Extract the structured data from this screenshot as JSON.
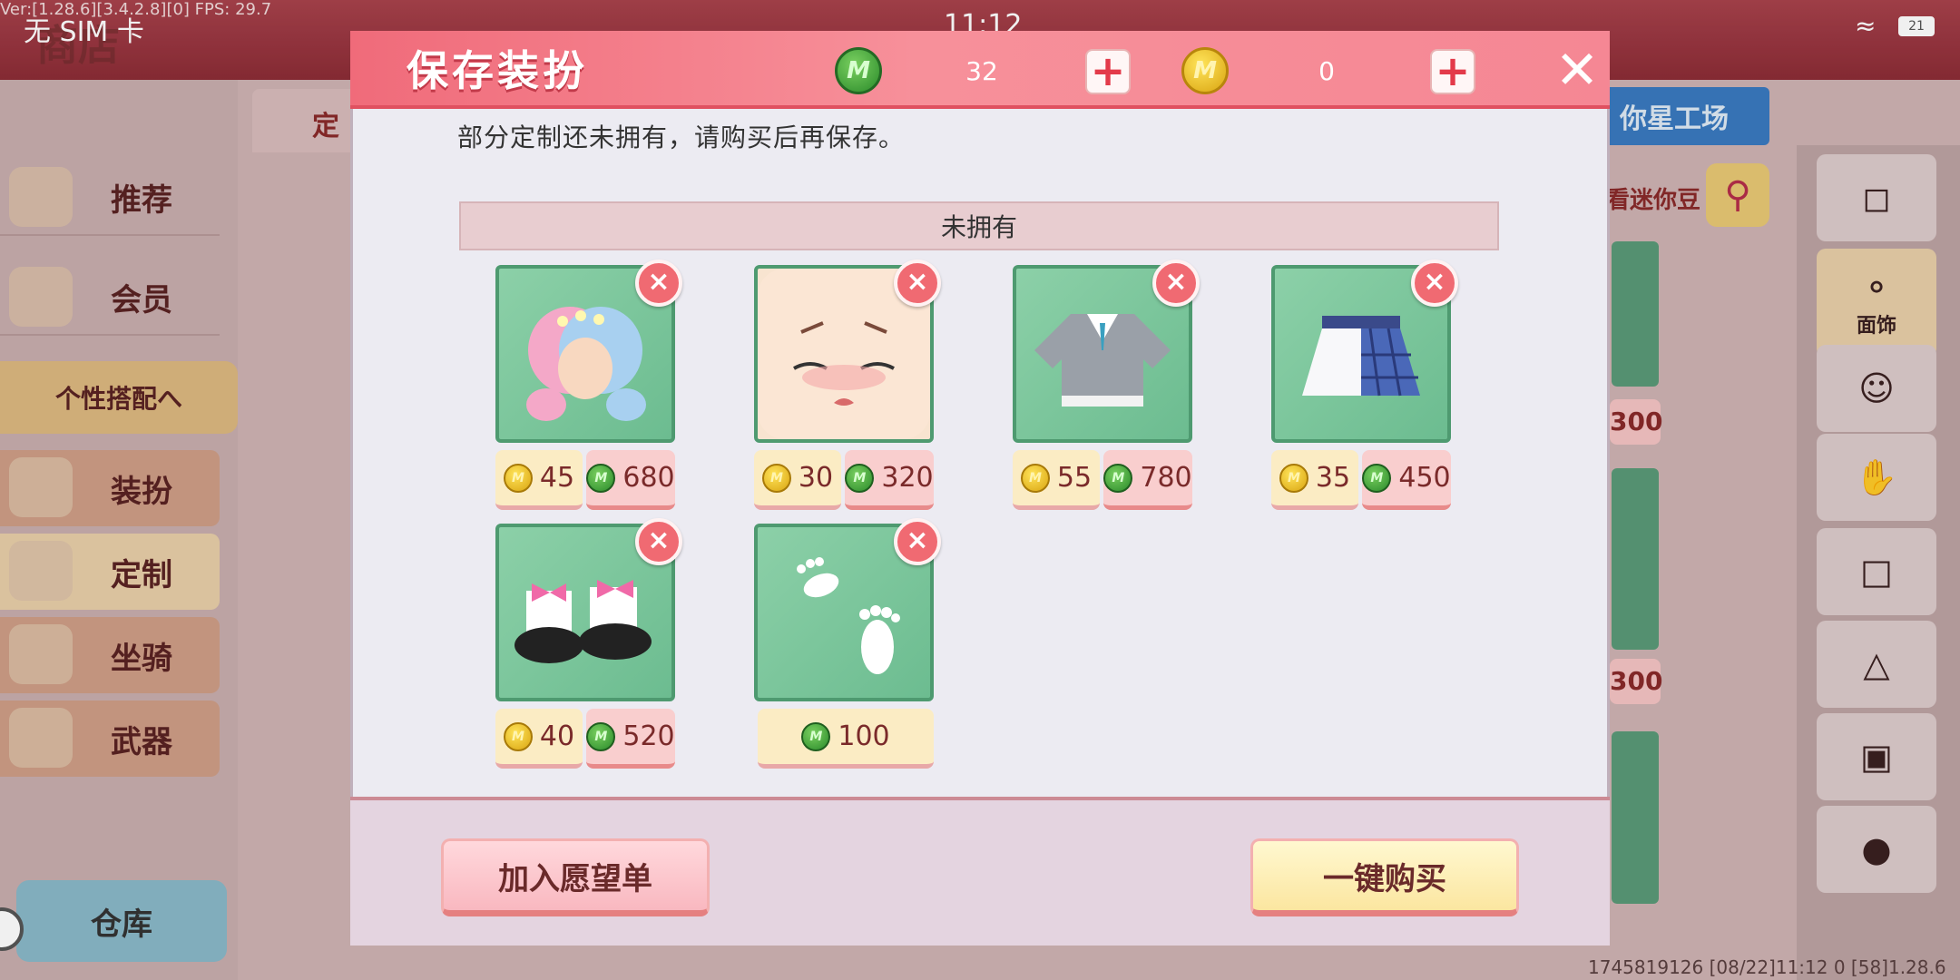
{
  "status_bar": {
    "version": "Ver:[1.28.6][3.4.2.8][0] FPS: 29.7",
    "carrier": "无 SIM 卡",
    "time": "11:12",
    "battery": "21"
  },
  "background": {
    "shop_title": "商店",
    "tab_label": "定",
    "side_menu": [
      {
        "label": "推荐"
      },
      {
        "label": "会员"
      },
      {
        "label": "个性搭配へ"
      },
      {
        "label": "装扮"
      },
      {
        "label": "定制"
      },
      {
        "label": "坐骑"
      },
      {
        "label": "武器"
      }
    ],
    "warehouse": "仓库",
    "mini_factory": "你星工场",
    "search_text": "看迷你豆",
    "category_active": "面饰",
    "card_price_1": "300",
    "card_price_2": "300",
    "footer_info": "1745819126   [08/22]11:12 0   [58]1.28.6"
  },
  "dialog": {
    "title": "保存装扮",
    "currency": {
      "gems": {
        "icon": "green-gem-coin",
        "value": "32"
      },
      "coins": {
        "icon": "gold-m-coin",
        "value": "0"
      }
    },
    "message": "部分定制还未拥有，请购买后再保存。",
    "section_title": "未拥有",
    "items": [
      {
        "name": "hair",
        "icon": "pastel-braided-hair",
        "gold": "45",
        "gems": "680"
      },
      {
        "name": "face",
        "icon": "crying-face",
        "gold": "30",
        "gems": "320"
      },
      {
        "name": "top",
        "icon": "grey-sweater-uniform",
        "gold": "55",
        "gems": "780"
      },
      {
        "name": "skirt",
        "icon": "plaid-skirt",
        "gold": "35",
        "gems": "450"
      },
      {
        "name": "shoes",
        "icon": "bow-shoes",
        "gold": "40",
        "gems": "520"
      },
      {
        "name": "footprint",
        "icon": "white-footprints",
        "gold": null,
        "gems": "100"
      }
    ],
    "wishlist_button": "加入愿望单",
    "buy_button": "一键购买"
  },
  "colors": {
    "header": "#f06b7a",
    "item_bg": "#8cd0a8",
    "remove": "#f06a72"
  }
}
